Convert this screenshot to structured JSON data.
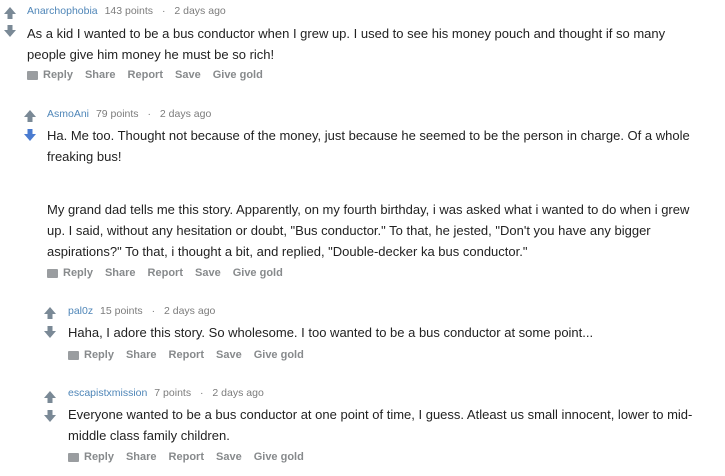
{
  "colors": {
    "upvote": "#7a8996",
    "downvote_active": "#4a7bd0",
    "username": "#4f86b8",
    "meta": "#7c7c7c",
    "action": "#878a8c"
  },
  "actions": {
    "reply": "Reply",
    "share": "Share",
    "report": "Report",
    "save": "Save",
    "give_gold": "Give gold"
  },
  "comments": [
    {
      "user": "Anarchophobia",
      "points": "143 points",
      "separator": "·",
      "time": "2 days ago",
      "body": [
        "As a kid I wanted to be a bus conductor when I grew up. I used to see his money pouch and thought if so many people give him money he must be so rich!"
      ]
    },
    {
      "user": "AsmoAni",
      "points": "79 points",
      "separator": "·",
      "time": "2 days ago",
      "body": [
        "Ha. Me too. Thought not because of the money, just because he seemed to be the person in charge. Of a whole freaking bus!",
        "My grand dad tells me this story. Apparently, on my fourth birthday, i was asked what i wanted to do when i grew up. I said, without any hesitation or doubt, \"Bus conductor.\" To that, he jested, \"Don't you have any bigger aspirations?\" To that, i thought a bit, and replied, \"Double-decker ka bus conductor.\""
      ]
    },
    {
      "user": "pal0z",
      "points": "15 points",
      "separator": "·",
      "time": "2 days ago",
      "body": [
        "Haha, I adore this story. So wholesome. I too wanted to be a bus conductor at some point..."
      ]
    },
    {
      "user": "escapistxmission",
      "points": "7 points",
      "separator": "·",
      "time": "2 days ago",
      "body": [
        "Everyone wanted to be a bus conductor at one point of time, I guess. Atleast us small innocent, lower to mid- middle class family children."
      ]
    }
  ]
}
